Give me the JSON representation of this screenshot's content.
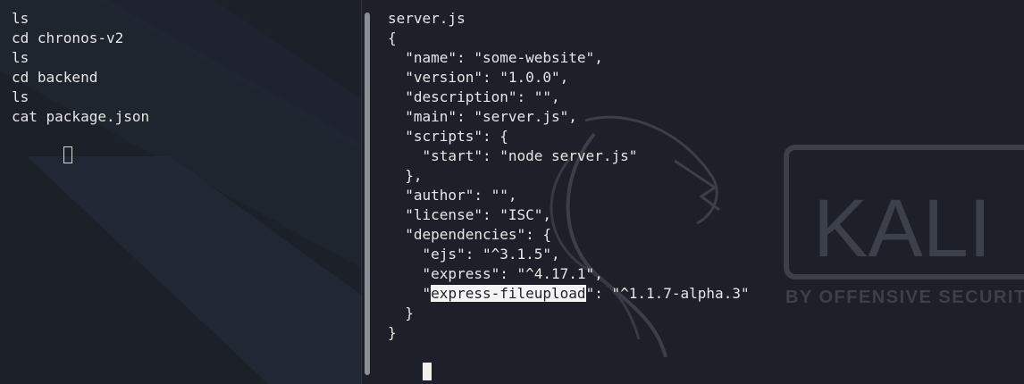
{
  "left_terminal": {
    "lines": [
      "ls",
      "cd chronos-v2",
      "ls",
      "cd backend",
      "ls",
      "cat package.json"
    ]
  },
  "right_terminal": {
    "lines": [
      "server.js",
      "{",
      "  \"name\": \"some-website\",",
      "  \"version\": \"1.0.0\",",
      "  \"description\": \"\",",
      "  \"main\": \"server.js\",",
      "  \"scripts\": {",
      "    \"start\": \"node server.js\"",
      "  },",
      "  \"author\": \"\",",
      "  \"license\": \"ISC\",",
      "  \"dependencies\": {",
      "    \"ejs\": \"^3.1.5\",",
      "    \"express\": \"^4.17.1\","
    ],
    "highlight_line": {
      "prefix": "    \"",
      "selected": "express-fileupload",
      "suffix": "\": \"^1.1.7-alpha.3\""
    },
    "closing_lines": [
      "  }",
      "}"
    ]
  },
  "wallpaper": {
    "logo_text": "KALI",
    "tagline": "BY OFFENSIVE SECURITY"
  },
  "colors": {
    "background": "#1d2029",
    "text": "#e6e6e6",
    "selection_bg": "#f4f4f4",
    "scrollbar": "#8b8f96"
  }
}
